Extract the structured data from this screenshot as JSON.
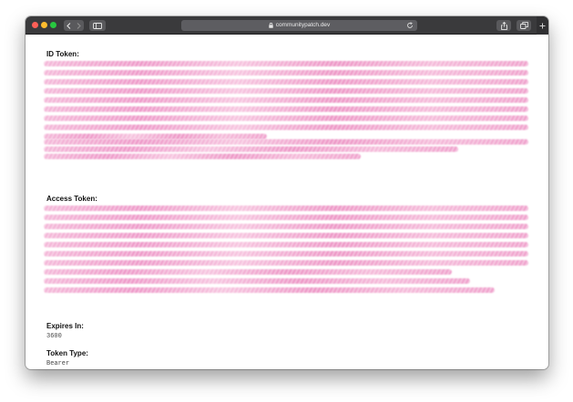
{
  "browser": {
    "url": "communitypatch.dev",
    "icons": {
      "back": "chevron-left-icon",
      "forward": "chevron-right-icon",
      "sidebar": "sidebar-icon",
      "lock": "lock-icon",
      "reload": "reload-icon",
      "share": "share-icon",
      "tabs": "tabs-icon",
      "new_tab": "plus-icon"
    }
  },
  "page": {
    "id_token": {
      "label": "ID Token:",
      "redacted": true
    },
    "access_token": {
      "label": "Access Token:",
      "redacted": true
    },
    "expires_in": {
      "label": "Expires In:",
      "value": "3600"
    },
    "token_type": {
      "label": "Token Type:",
      "value": "Bearer"
    }
  },
  "colors": {
    "redaction": "#ea7fbb",
    "chrome": "#3a3a3c"
  }
}
